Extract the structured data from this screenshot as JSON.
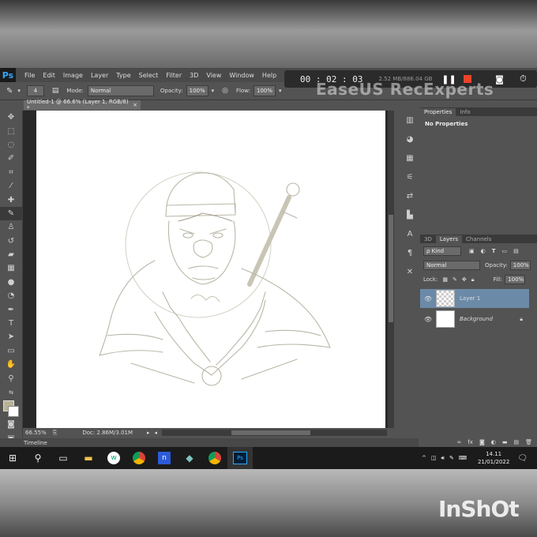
{
  "app": {
    "logo": "Ps",
    "menu": [
      "File",
      "Edit",
      "Image",
      "Layer",
      "Type",
      "Select",
      "Filter",
      "3D",
      "View",
      "Window",
      "Help"
    ]
  },
  "recorder": {
    "time": "00 : 02 : 03",
    "size": "2.52 MB/886.04 GB",
    "watermark": "EaseUS RecExperts"
  },
  "options": {
    "brush_size": "4",
    "mode_label": "Mode:",
    "mode_value": "Normal",
    "opacity_label": "Opacity:",
    "opacity_value": "100%",
    "flow_label": "Flow:",
    "flow_value": "100%"
  },
  "document": {
    "tab_title": "Untitled-1 @ 66.6% (Layer 1, RGB/8) *",
    "zoom": "66.55%",
    "doc_info": "Doc: 2.86M/3.01M"
  },
  "timeline": {
    "label": "Timeline"
  },
  "properties_panel": {
    "tabs": [
      "Properties",
      "Info"
    ],
    "content": "No Properties"
  },
  "layers_panel": {
    "tabs": [
      "3D",
      "Layers",
      "Channels"
    ],
    "kind": "ρ Kind",
    "blend_mode": "Normal",
    "opacity_label": "Opacity:",
    "opacity_value": "100%",
    "lock_label": "Lock:",
    "fill_label": "Fill:",
    "fill_value": "100%",
    "layers": [
      {
        "name": "Layer 1",
        "selected": true
      },
      {
        "name": "Background",
        "selected": false
      }
    ]
  },
  "taskbar": {
    "time": "14.11",
    "date": "21/01/2022"
  },
  "watermark_bottom": "InShOt",
  "colors": {
    "ps_blue": "#31a8ff",
    "layer_selected": "#6b8aa8",
    "foreground": "#b8b294",
    "record_red": "#e8442c"
  }
}
